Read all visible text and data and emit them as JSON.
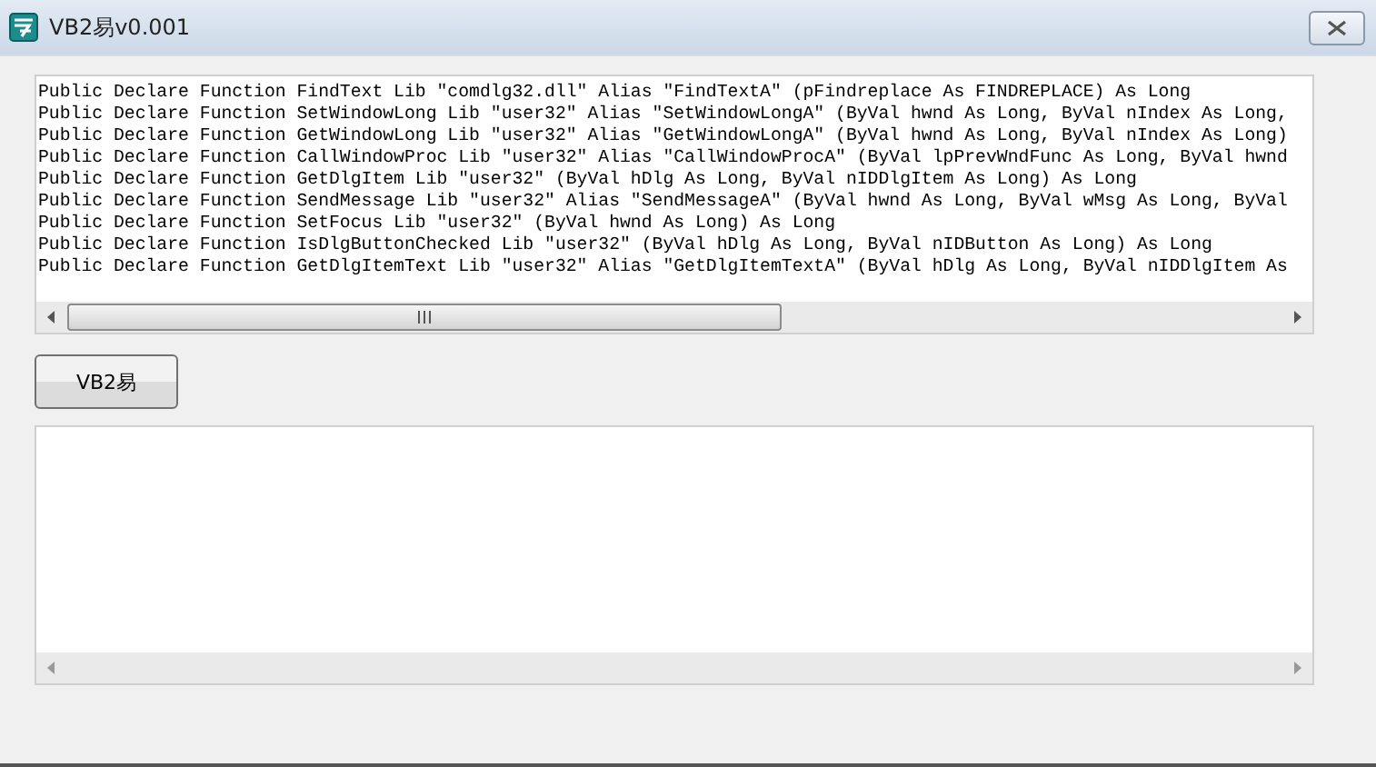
{
  "window": {
    "title": "VB2易v0.001"
  },
  "code_box": {
    "lines": [
      "Public Declare Function FindText Lib \"comdlg32.dll\" Alias \"FindTextA\" (pFindreplace As FINDREPLACE) As Long",
      "Public Declare Function SetWindowLong Lib \"user32\" Alias \"SetWindowLongA\" (ByVal hwnd As Long, ByVal nIndex As Long,",
      "Public Declare Function GetWindowLong Lib \"user32\" Alias \"GetWindowLongA\" (ByVal hwnd As Long, ByVal nIndex As Long)",
      "Public Declare Function CallWindowProc Lib \"user32\" Alias \"CallWindowProcA\" (ByVal lpPrevWndFunc As Long, ByVal hwnd",
      "Public Declare Function GetDlgItem Lib \"user32\" (ByVal hDlg As Long, ByVal nIDDlgItem As Long) As Long",
      "Public Declare Function SendMessage Lib \"user32\" Alias \"SendMessageA\" (ByVal hwnd As Long, ByVal wMsg As Long, ByVal",
      "Public Declare Function SetFocus Lib \"user32\" (ByVal hwnd As Long) As Long",
      "Public Declare Function IsDlgButtonChecked Lib \"user32\" (ByVal hDlg As Long, ByVal nIDButton As Long) As Long",
      "Public Declare Function GetDlgItemText Lib \"user32\" Alias \"GetDlgItemTextA\" (ByVal hDlg As Long, ByVal nIDDlgItem As"
    ]
  },
  "button": {
    "label": "VB2易"
  }
}
